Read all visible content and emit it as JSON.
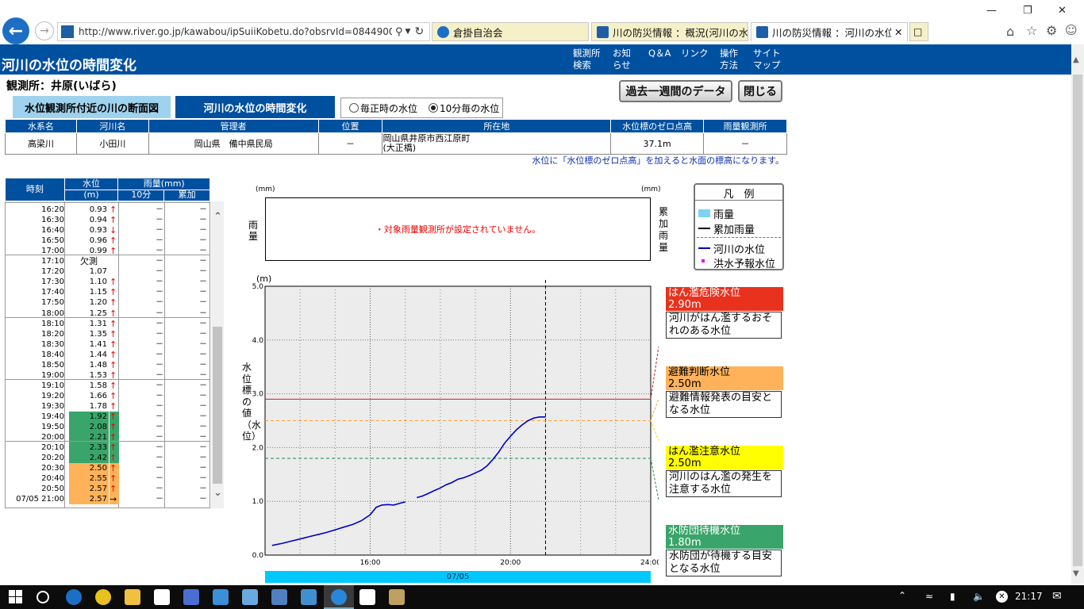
{
  "browser": {
    "url": "http://www.river.go.jp/kawabou/ipSuiiKobetu.do?obsrvId=0844900400028",
    "tabs": [
      {
        "label": "倉掛自治会"
      },
      {
        "label": "川の防災情報 ：概況(河川の水..."
      },
      {
        "label": "川の防災情報 ：河川の水位..."
      }
    ],
    "clock": "21:17"
  },
  "page": {
    "title": "河川の水位の時間変化",
    "nav": [
      "観測所\n検索",
      "お知\nらせ",
      "Q＆A",
      "リンク",
      "操作\n方法",
      "サイト\nマップ"
    ],
    "station": "観測所：井原(いばら)",
    "tab_cross": "水位観測所付近の川の断面図",
    "tab_time": "河川の水位の時間変化",
    "radio1": "毎正時の水位",
    "radio2": "10分毎の水位",
    "btn_week": "過去一週間のデータ",
    "btn_close": "閉じる",
    "note": "水位に「水位標のゼロ点高」を加えると水面の標高になります。"
  },
  "info": {
    "headers": [
      "水系名",
      "河川名",
      "管理者",
      "位置",
      "所在地",
      "水位標のゼロ点高",
      "雨量観測所"
    ],
    "values": [
      "高梁川",
      "小田川",
      "岡山県　備中県民局",
      "－",
      "岡山県井原市西江原町\n(大正橋)",
      "37.1m",
      "－"
    ]
  },
  "table": {
    "h_time": "時刻",
    "h_level": "水位",
    "h_unit": "(m)",
    "h_rain": "雨量(mm)",
    "h_10": "10分",
    "h_cum": "累加",
    "rows": [
      [
        "16:20",
        "0.93",
        "↑"
      ],
      [
        "16:30",
        "0.94",
        "↑"
      ],
      [
        "16:40",
        "0.93",
        "↓"
      ],
      [
        "16:50",
        "0.96",
        "↑"
      ],
      [
        "17:00",
        "0.99",
        "↑"
      ],
      [
        "17:10",
        "欠測",
        ""
      ],
      [
        "17:20",
        "1.07",
        ""
      ],
      [
        "17:30",
        "1.10",
        "↑"
      ],
      [
        "17:40",
        "1.15",
        "↑"
      ],
      [
        "17:50",
        "1.20",
        "↑"
      ],
      [
        "18:00",
        "1.25",
        "↑"
      ],
      [
        "18:10",
        "1.31",
        "↑"
      ],
      [
        "18:20",
        "1.35",
        "↑"
      ],
      [
        "18:30",
        "1.41",
        "↑"
      ],
      [
        "18:40",
        "1.44",
        "↑"
      ],
      [
        "18:50",
        "1.48",
        "↑"
      ],
      [
        "19:00",
        "1.53",
        "↑"
      ],
      [
        "19:10",
        "1.58",
        "↑"
      ],
      [
        "19:20",
        "1.66",
        "↑"
      ],
      [
        "19:30",
        "1.78",
        "↑"
      ],
      [
        "19:40",
        "1.92",
        "↑"
      ],
      [
        "19:50",
        "2.08",
        "↑"
      ],
      [
        "20:00",
        "2.21",
        "↑"
      ],
      [
        "20:10",
        "2.33",
        "↑"
      ],
      [
        "20:20",
        "2.42",
        "↑"
      ],
      [
        "20:30",
        "2.50",
        "↑"
      ],
      [
        "20:40",
        "2.55",
        "↑"
      ],
      [
        "20:50",
        "2.57",
        "↑"
      ],
      [
        "07/05 21:00",
        "2.57",
        "→"
      ]
    ],
    "dash": "－"
  },
  "rain_chart": {
    "unit_l": "(mm)",
    "unit_r": "(mm)",
    "label_l": "雨\n量",
    "label_r": "累\n加\n雨\n量",
    "message": "・対象雨量観測所が設定されていません。"
  },
  "legend": {
    "title": "凡　例",
    "items": [
      "雨量",
      "累加雨量",
      "河川の水位",
      "洪水予報水位"
    ]
  },
  "levels": [
    {
      "name": "はん濫危険水位",
      "value": "2.90m",
      "desc": "河川がはん濫するおそれのある水位",
      "color": "#e8321e"
    },
    {
      "name": "避難判断水位",
      "value": "2.50m",
      "desc": "避難情報発表の目安となる水位",
      "color": "#ffb25a"
    },
    {
      "name": "はん濫注意水位",
      "value": "2.50m",
      "desc": "河川のはん濫の発生を注意する水位",
      "color": "#ffff00"
    },
    {
      "name": "水防団待機水位",
      "value": "1.80m",
      "desc": "水防団が待機する目安となる水位",
      "color": "#3aa56a"
    }
  ],
  "chart_data": {
    "type": "line",
    "ylabel": "水位標の値（水位）",
    "yunit": "(m)",
    "ylim": [
      0,
      5
    ],
    "yticks": [
      "5.0",
      "4.0",
      "3.0",
      "2.0",
      "1.0",
      "0.0"
    ],
    "xticks": [
      "16:00",
      "20:00",
      "24:00"
    ],
    "date": "07/05",
    "xlim": [
      13,
      24
    ],
    "series": [
      {
        "x": [
          13.2,
          13.5,
          13.75,
          14.0,
          14.25,
          14.5,
          14.75,
          15.0,
          15.25,
          15.5,
          15.75,
          16.0,
          16.17,
          16.33,
          16.5,
          16.67,
          16.83,
          17.0
        ],
        "y": [
          0.18,
          0.22,
          0.26,
          0.3,
          0.34,
          0.38,
          0.42,
          0.47,
          0.52,
          0.57,
          0.64,
          0.75,
          0.89,
          0.93,
          0.94,
          0.93,
          0.96,
          0.99
        ]
      },
      {
        "x": [
          17.33,
          17.5,
          17.67,
          17.83,
          18.0,
          18.17,
          18.33,
          18.5,
          18.67,
          18.83,
          19.0,
          19.17,
          19.33,
          19.5,
          19.67,
          19.83,
          20.0,
          20.17,
          20.33,
          20.5,
          20.67,
          20.83,
          21.0
        ],
        "y": [
          1.07,
          1.1,
          1.15,
          1.2,
          1.25,
          1.31,
          1.35,
          1.41,
          1.44,
          1.48,
          1.53,
          1.58,
          1.66,
          1.78,
          1.92,
          2.08,
          2.21,
          2.33,
          2.42,
          2.5,
          2.55,
          2.57,
          2.57
        ]
      }
    ],
    "thresholds": [
      2.9,
      2.5,
      1.8
    ]
  }
}
